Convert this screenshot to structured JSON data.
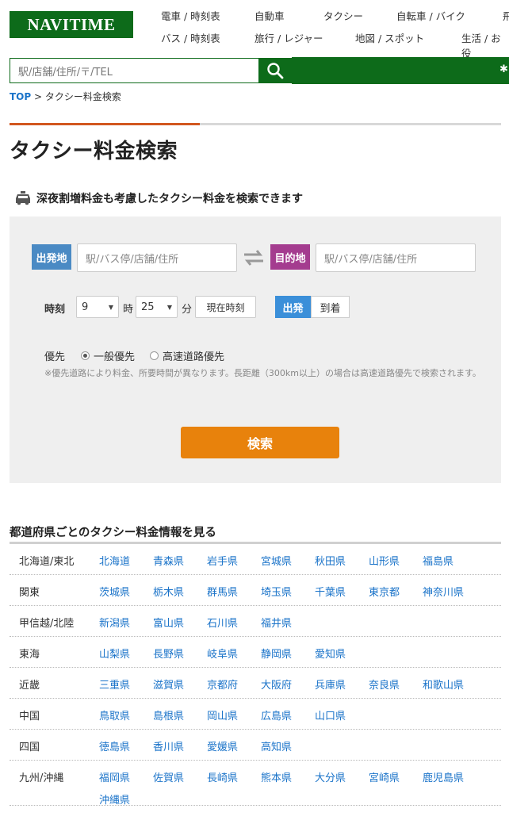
{
  "header": {
    "logo": "NAVITIME",
    "nav_row1": [
      "電車 / 時刻表",
      "自動車",
      "タクシー",
      "自転車 / バイク",
      "飛"
    ],
    "nav_row2": [
      "バス / 時刻表",
      "旅行 / レジャー",
      "地図 / スポット",
      "生活 / お役"
    ],
    "search_placeholder": "駅/店舗/住所/〒/TEL"
  },
  "breadcrumb": {
    "top": "TOP",
    "separator": ">",
    "current": "タクシー料金検索"
  },
  "page_title": "タクシー料金検索",
  "subhead": "深夜割増料金も考慮したタクシー料金を検索できます",
  "form": {
    "departure_tag": "出発地",
    "departure_placeholder": "駅/バス停/店舗/住所",
    "arrival_tag": "目的地",
    "arrival_placeholder": "駅/バス停/店舗/住所",
    "time_label": "時刻",
    "hour_value": "9",
    "hour_unit": "時",
    "minute_value": "25",
    "minute_unit": "分",
    "now_button": "現在時刻",
    "mode_departure": "出発",
    "mode_arrival": "到着",
    "priority_label": "優先",
    "priority_general": "一般優先",
    "priority_highway": "高速道路優先",
    "note": "※優先道路により料金、所要時間が異なります。長距離（300km以上）の場合は高速道路優先で検索されます。",
    "submit": "検索"
  },
  "prefectures": {
    "title": "都道府県ごとのタクシー料金情報を見る",
    "rows": [
      {
        "region": "北海道/東北",
        "items": [
          "北海道",
          "青森県",
          "岩手県",
          "宮城県",
          "秋田県",
          "山形県",
          "福島県"
        ]
      },
      {
        "region": "関東",
        "items": [
          "茨城県",
          "栃木県",
          "群馬県",
          "埼玉県",
          "千葉県",
          "東京都",
          "神奈川県"
        ]
      },
      {
        "region": "甲信越/北陸",
        "items": [
          "新潟県",
          "富山県",
          "石川県",
          "福井県"
        ]
      },
      {
        "region": "東海",
        "items": [
          "山梨県",
          "長野県",
          "岐阜県",
          "静岡県",
          "愛知県"
        ]
      },
      {
        "region": "近畿",
        "items": [
          "三重県",
          "滋賀県",
          "京都府",
          "大阪府",
          "兵庫県",
          "奈良県",
          "和歌山県"
        ]
      },
      {
        "region": "中国",
        "items": [
          "鳥取県",
          "島根県",
          "岡山県",
          "広島県",
          "山口県"
        ]
      },
      {
        "region": "四国",
        "items": [
          "徳島県",
          "香川県",
          "愛媛県",
          "高知県"
        ]
      },
      {
        "region": "九州/沖縄",
        "items": [
          "福岡県",
          "佐賀県",
          "長崎県",
          "熊本県",
          "大分県",
          "宮崎県",
          "鹿児島県",
          "沖縄県"
        ]
      }
    ]
  }
}
